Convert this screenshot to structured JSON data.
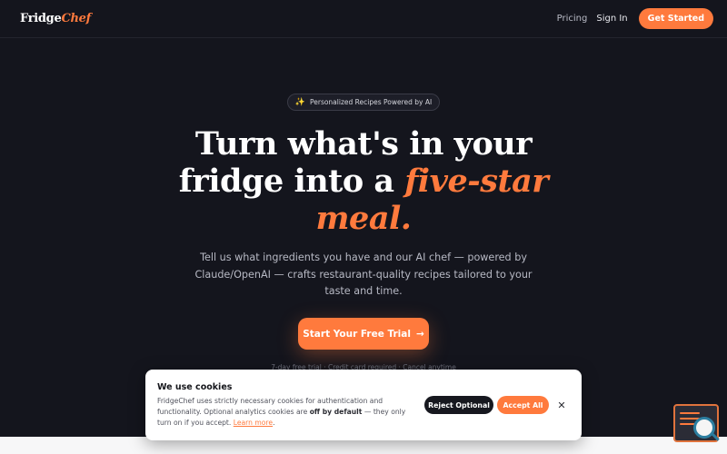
{
  "brand": {
    "part1": "Fridge",
    "part2": "Chef"
  },
  "nav": {
    "pricing": "Pricing",
    "sign_in": "Sign In",
    "get_started": "Get Started"
  },
  "hero": {
    "badge": "Personalized Recipes Powered by AI",
    "title_line1": "Turn what's in your",
    "title_line2": "fridge into a ",
    "title_accent1": "five-star",
    "title_accent2": "meal.",
    "subtitle": "Tell us what ingredients you have and our AI chef — powered by Claude/OpenAI — crafts restaurant-quality recipes tailored to your taste and time.",
    "cta": "Start Your Free Trial",
    "cta_arrow": "→",
    "trial_note": "7-day free trial · Credit card required · Cancel anytime"
  },
  "cookie": {
    "title": "We use cookies",
    "text1": "FridgeChef uses strictly necessary cookies for authentication and functionality. Optional analytics cookies are ",
    "bold": "off by default",
    "text2": " — they only turn on if you accept. ",
    "learn_more": "Learn more",
    "period": ".",
    "reject": "Reject Optional",
    "accept": "Accept All",
    "close": "✕"
  },
  "colors": {
    "accent": "#ff7a3d",
    "background": "#14151d",
    "dark_button": "#17181f"
  },
  "icons": {
    "badge_icon": "sparkle-icon",
    "widget_icon": "code-search-icon"
  }
}
